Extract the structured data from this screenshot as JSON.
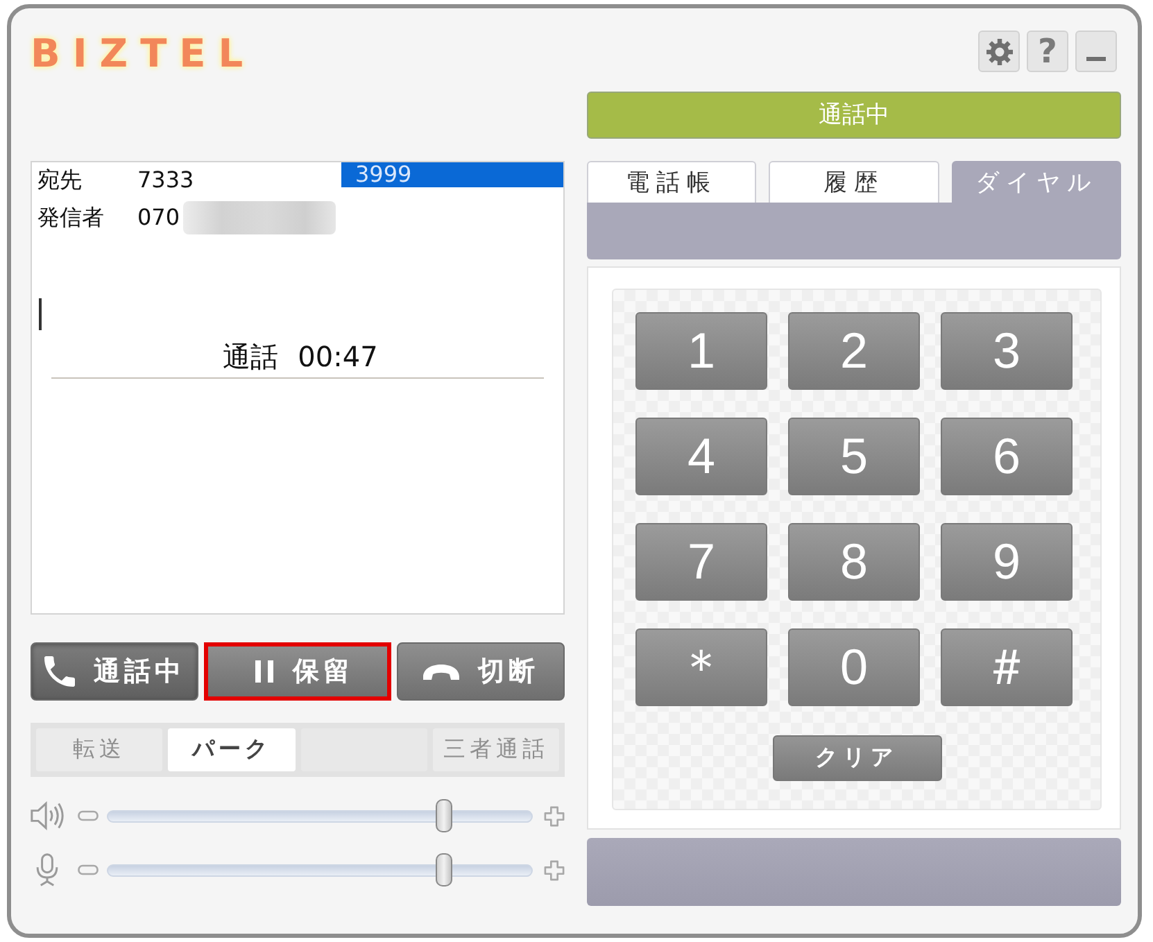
{
  "logo": "BIZTEL",
  "window_buttons": [
    {
      "kind": "settings"
    },
    {
      "kind": "help",
      "label": "?"
    },
    {
      "kind": "minimize"
    }
  ],
  "status_bar": {
    "label": "通話中"
  },
  "call_info": {
    "rows": [
      {
        "label": "宛先",
        "value": "7333"
      },
      {
        "label": "発信者",
        "value": "070",
        "redacted": true
      }
    ],
    "highlighted_entry": {
      "text": "3999",
      "selected": true
    },
    "caret": true,
    "call_status": {
      "label": "通話",
      "duration": "00:47"
    }
  },
  "call_buttons": [
    {
      "kind": "phone",
      "label": "通話中",
      "active": true,
      "highlighted": false
    },
    {
      "kind": "pause",
      "label": "保留",
      "active": false,
      "highlighted": true
    },
    {
      "kind": "hangup",
      "label": "切断",
      "active": false,
      "highlighted": false
    }
  ],
  "feature_buttons": [
    {
      "kind": "button",
      "label": "転送",
      "disabled": true
    },
    {
      "kind": "button",
      "label": "パーク",
      "disabled": false
    },
    {
      "kind": "blank"
    },
    {
      "kind": "button",
      "label": "三者通話",
      "disabled": true
    }
  ],
  "volume_sliders": [
    {
      "kind": "speaker",
      "level": 0.79
    },
    {
      "kind": "microphone",
      "level": 0.79
    }
  ],
  "tabs": [
    {
      "label": "電話帳",
      "selected": false
    },
    {
      "label": "履歴",
      "selected": false
    },
    {
      "label": "ダイヤル",
      "selected": true
    }
  ],
  "keypad": {
    "keys": [
      "1",
      "2",
      "3",
      "4",
      "5",
      "6",
      "7",
      "8",
      "9",
      "＊",
      "0",
      "＃"
    ],
    "clear_label": "クリア"
  }
}
